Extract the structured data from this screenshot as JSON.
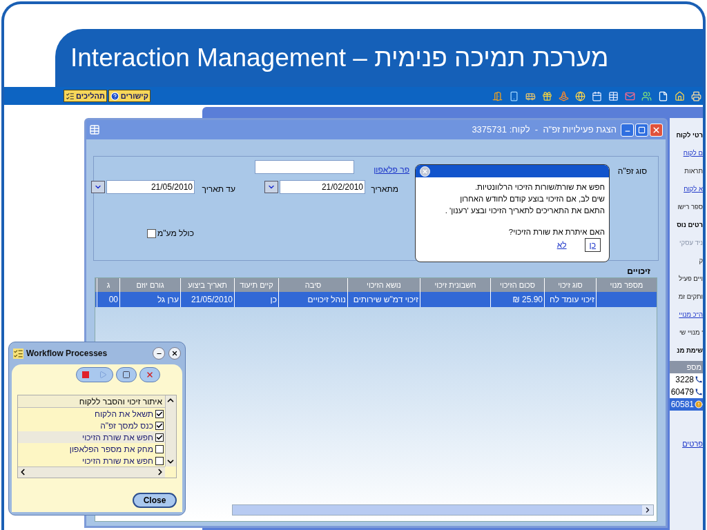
{
  "slide": {
    "title": "Interaction Management – מערכת תמיכה פנימית"
  },
  "toolbar": {
    "buttons": [
      {
        "label": "קישורים",
        "kind": "help"
      },
      {
        "label": "תהליכים",
        "kind": "list"
      }
    ]
  },
  "side_panel": {
    "items": [
      {
        "text": "רטי לקוח",
        "kind": "heading"
      },
      {
        "text": "ם לקוח",
        "kind": "link"
      },
      {
        "text": "תראות",
        "kind": "label"
      },
      {
        "text": "א לקוח",
        "kind": "link"
      },
      {
        "text": "ספר רישו",
        "kind": "label"
      },
      {
        "text": "רטים נוס",
        "kind": "heading"
      },
      {
        "text": "ניד עסקי",
        "kind": "disabled"
      },
      {
        "text": "ק",
        "kind": "label"
      },
      {
        "text": "ויים פעיל",
        "kind": "label"
      },
      {
        "text": "ותקים זמ",
        "kind": "label"
      },
      {
        "text": "ה\"כ מנויי",
        "kind": "link"
      },
      {
        "text": "' מנויי שי",
        "kind": "label"
      },
      {
        "text": "שימת מנ",
        "kind": "heading"
      }
    ],
    "column": "מספ",
    "rows": [
      {
        "number": "3228",
        "kind": "phone",
        "selected": false
      },
      {
        "number": "60479",
        "kind": "phone",
        "selected": false
      },
      {
        "number": "60581",
        "kind": "warning",
        "selected": true
      }
    ],
    "link": "פרטים"
  },
  "dialog": {
    "title": "הצגת פעילויות זפ\"ה  -  לקוח: 3375731",
    "form": {
      "type_label": "סוג זפ\"ה",
      "phone_link": "פר פלאפון",
      "from_label": "מתאריך",
      "from_value": "21/02/2010",
      "to_label": "עד תאריך",
      "to_value": "21/05/2010",
      "vat_label": "כולל מע\"מ",
      "vat_checked": false
    },
    "popup": {
      "lines": [
        "חפש את שורת/שורות הזיכוי הרלוונטיות.",
        "שים לב, אם הזיכוי בוצע קודם לחודש האחרון",
        "התאם את התאריכים לתאריך הזיכוי ובצע 'רענון' ."
      ],
      "question": "האם איתרת את שורת הזיכוי?",
      "yes": "כן",
      "no": "לא"
    },
    "table": {
      "title": "זיכויים",
      "columns": [
        "מספר מנוי",
        "סוג זיכוי",
        "סכום הזיכוי",
        "חשבונית זיכוי",
        "נושא הזיכוי",
        "סיבה",
        "קיים תיעוד",
        "תאריך ביצוע",
        "גורם יוזם",
        "ג"
      ],
      "rows": [
        {
          "selected": true,
          "cells": [
            null,
            "זיכוי עומד לח",
            "25.90 ₪",
            null,
            "זיכוי דמ\"ש שירותים",
            "נוהל זיכויים",
            "כן",
            "21/05/2010",
            "ערן גל",
            "00"
          ]
        }
      ]
    }
  },
  "workflow": {
    "title": "Workflow Processes",
    "list_title": "איתור זיכוי והסבר ללקוח",
    "steps": [
      {
        "label": "תשאל את הלקוח",
        "checked": true,
        "selected": false
      },
      {
        "label": "כנס למסך זפ\"ה",
        "checked": true,
        "selected": false
      },
      {
        "label": "חפש את שורת הזיכוי",
        "checked": true,
        "selected": true
      },
      {
        "label": "מחק את מספר הפלאפון",
        "checked": false,
        "selected": false
      },
      {
        "label": "חפש את שורת הזיכוי",
        "checked": false,
        "selected": false
      }
    ],
    "close": "Close"
  }
}
